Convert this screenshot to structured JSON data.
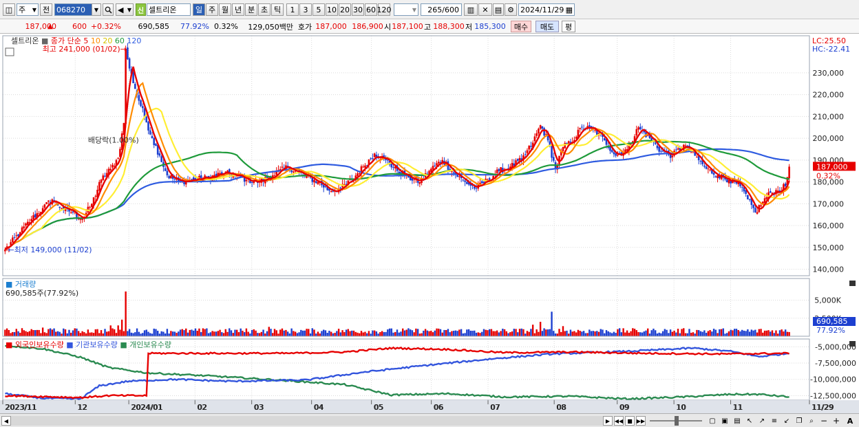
{
  "toolbar": {
    "market_type": "주",
    "prev_label": "전",
    "code": "068270",
    "name_prefix": "신",
    "stock_name": "셀트리온",
    "periods": [
      "일",
      "주",
      "월",
      "년",
      "분",
      "초",
      "틱"
    ],
    "minutes": [
      "1",
      "3",
      "5",
      "10",
      "20",
      "30",
      "60",
      "120"
    ],
    "count": "265",
    "count_total": "/600",
    "date": "2024/11/29"
  },
  "quote": {
    "price": "187,000",
    "arrow": "▲",
    "change": "600",
    "change_pct": "+0.32%",
    "volume": "690,585",
    "vol_ratio": "77.92%",
    "pct2": "0.32%",
    "amount": "129,050백만",
    "ask_label": "호가",
    "ask1": "187,000",
    "ask2": "186,900",
    "open_label": "시",
    "open": "187,100",
    "high_label": "고",
    "high": "188,300",
    "low_label": "저",
    "low": "185,300",
    "buy": "매수",
    "sell": "매도",
    "even": "평"
  },
  "colors": {
    "ma5": "#e60000",
    "ma10": "#ff8c00",
    "ma20": "#ffee33",
    "ma60": "#1e9a3a",
    "ma120": "#2e5be0",
    "up": "#e60000",
    "down": "#1c3fd0",
    "foreign": "#e60000",
    "inst": "#3355dd",
    "indiv": "#2a8a50"
  },
  "chart_data": [
    {
      "type": "candlestick",
      "title": "셀트리온",
      "legend": {
        "price_label": "종가 단순",
        "ma_periods": [
          "5",
          "10",
          "20",
          "60",
          "120"
        ]
      },
      "ylim": [
        137000,
        247000
      ],
      "y_ticks": [
        140000,
        150000,
        160000,
        170000,
        180000,
        190000,
        200000,
        210000,
        220000,
        230000
      ],
      "y_tick_labels": [
        "140,000",
        "150,000",
        "160,000",
        "170,000",
        "180,000",
        "190,000",
        "200,000",
        "210,000",
        "220,000",
        "230,000"
      ],
      "x_tick_labels": [
        "2023/11",
        "12",
        "2024/01",
        "02",
        "03",
        "04",
        "05",
        "06",
        "07",
        "08",
        "09",
        "10",
        "11",
        "11/29"
      ],
      "x_tick_positions": [
        0.0,
        0.115,
        0.2,
        0.305,
        0.395,
        0.49,
        0.585,
        0.68,
        0.77,
        0.875,
        0.975,
        1.065,
        1.155,
        1.28
      ],
      "annotations": {
        "high": "최고 241,000 (01/02)",
        "low": "최저 149,000 (11/02)",
        "dividend": "배당락(1.00%)",
        "lc": "LC:25.50",
        "hc": "HC:-22.41",
        "last_price": "187,000",
        "last_pct": "0.32%"
      },
      "close_anchors": [
        [
          0,
          149000
        ],
        [
          8,
          157000
        ],
        [
          14,
          163000
        ],
        [
          20,
          168000
        ],
        [
          25,
          172000
        ],
        [
          30,
          168000
        ],
        [
          36,
          166000
        ],
        [
          41,
          163000
        ],
        [
          46,
          170000
        ],
        [
          51,
          181000
        ],
        [
          56,
          186000
        ],
        [
          60,
          191000
        ],
        [
          63,
          207000
        ],
        [
          64,
          241000
        ],
        [
          66,
          232000
        ],
        [
          70,
          220000
        ],
        [
          74,
          210000
        ],
        [
          78,
          200000
        ],
        [
          82,
          192000
        ],
        [
          86,
          183000
        ],
        [
          92,
          180000
        ],
        [
          100,
          181000
        ],
        [
          108,
          182000
        ],
        [
          116,
          184000
        ],
        [
          122,
          183000
        ],
        [
          128,
          181000
        ],
        [
          135,
          180000
        ],
        [
          142,
          183000
        ],
        [
          150,
          187000
        ],
        [
          158,
          183000
        ],
        [
          166,
          180000
        ],
        [
          172,
          176000
        ],
        [
          178,
          177000
        ],
        [
          184,
          181000
        ],
        [
          190,
          187000
        ],
        [
          196,
          193000
        ],
        [
          202,
          190000
        ],
        [
          208,
          185000
        ],
        [
          214,
          182000
        ],
        [
          220,
          180000
        ],
        [
          226,
          186000
        ],
        [
          232,
          190000
        ],
        [
          238,
          184000
        ],
        [
          244,
          180000
        ],
        [
          250,
          177000
        ],
        [
          256,
          181000
        ],
        [
          262,
          185000
        ],
        [
          268,
          187000
        ],
        [
          274,
          190000
        ],
        [
          280,
          198000
        ],
        [
          284,
          206000
        ],
        [
          288,
          199000
        ],
        [
          292,
          186000
        ],
        [
          296,
          196000
        ],
        [
          300,
          198000
        ],
        [
          306,
          205000
        ],
        [
          312,
          204000
        ],
        [
          318,
          199000
        ],
        [
          324,
          192000
        ],
        [
          330,
          195000
        ],
        [
          336,
          205000
        ],
        [
          342,
          200000
        ],
        [
          348,
          194000
        ],
        [
          354,
          192000
        ],
        [
          360,
          197000
        ],
        [
          366,
          192000
        ],
        [
          372,
          186000
        ],
        [
          378,
          183000
        ],
        [
          384,
          181000
        ],
        [
          390,
          178000
        ],
        [
          394,
          172000
        ],
        [
          398,
          166000
        ],
        [
          402,
          171000
        ],
        [
          406,
          175000
        ],
        [
          410,
          176000
        ],
        [
          414,
          178000
        ],
        [
          416,
          187000
        ]
      ]
    },
    {
      "type": "bar",
      "title": "거래량",
      "value_label": "690,585주(77.92%)",
      "ylim": [
        0,
        8000000
      ],
      "y_ticks": [
        2500000,
        5000000
      ],
      "y_tick_labels": [
        "2,500K",
        "5,000K"
      ],
      "last_value_label": "690,585",
      "last_pct_label": "77.92%",
      "spikes": [
        [
          64,
          6200000
        ],
        [
          62,
          2300000
        ],
        [
          60,
          1500000
        ],
        [
          56,
          1500000
        ],
        [
          290,
          3400000
        ],
        [
          284,
          2000000
        ],
        [
          280,
          1600000
        ],
        [
          296,
          1400000
        ],
        [
          140,
          1300000
        ],
        [
          20,
          1200000
        ]
      ],
      "base_volume": 700000
    },
    {
      "type": "line",
      "series_names": [
        "외국인보유수량",
        "기관보유수량",
        "개인보유수량"
      ],
      "ylim": [
        -13200000,
        -3800000
      ],
      "y_ticks": [
        -5000000,
        -7500000,
        -10000000,
        -12500000
      ],
      "y_tick_labels": [
        "-5,000,000",
        "-7,500,000",
        "-10,000,000",
        "-12,500,000"
      ],
      "series": [
        {
          "name": "외국인보유수량",
          "points": [
            [
              0,
              -12500000
            ],
            [
              40,
              -12800000
            ],
            [
              55,
              -12500000
            ],
            [
              75,
              -12500000
            ],
            [
              76,
              -6000000
            ],
            [
              110,
              -6000000
            ],
            [
              150,
              -6000000
            ],
            [
              180,
              -5800000
            ],
            [
              205,
              -5200000
            ],
            [
              235,
              -5400000
            ],
            [
              265,
              -5900000
            ],
            [
              300,
              -5800000
            ],
            [
              340,
              -6000000
            ],
            [
              380,
              -6100000
            ],
            [
              416,
              -6000000
            ]
          ]
        },
        {
          "name": "기관보유수량",
          "points": [
            [
              0,
              -12200000
            ],
            [
              20,
              -12900000
            ],
            [
              40,
              -13000000
            ],
            [
              50,
              -11000000
            ],
            [
              65,
              -10300000
            ],
            [
              90,
              -10000000
            ],
            [
              120,
              -10300000
            ],
            [
              160,
              -10100000
            ],
            [
              190,
              -8900000
            ],
            [
              225,
              -7800000
            ],
            [
              260,
              -6800000
            ],
            [
              290,
              -6100000
            ],
            [
              330,
              -5700000
            ],
            [
              365,
              -5200000
            ],
            [
              385,
              -5700000
            ],
            [
              400,
              -6500000
            ],
            [
              416,
              -6000000
            ]
          ]
        },
        {
          "name": "개인보유수량",
          "points": [
            [
              0,
              -4800000
            ],
            [
              20,
              -5300000
            ],
            [
              40,
              -6600000
            ],
            [
              55,
              -8200000
            ],
            [
              75,
              -9000000
            ],
            [
              110,
              -9500000
            ],
            [
              150,
              -10200000
            ],
            [
              180,
              -10800000
            ],
            [
              205,
              -12400000
            ],
            [
              235,
              -12200000
            ],
            [
              265,
              -12700000
            ],
            [
              300,
              -12600000
            ],
            [
              330,
              -13000000
            ],
            [
              360,
              -12700000
            ],
            [
              385,
              -12300000
            ],
            [
              400,
              -12300000
            ],
            [
              416,
              -12700000
            ]
          ]
        }
      ]
    }
  ]
}
